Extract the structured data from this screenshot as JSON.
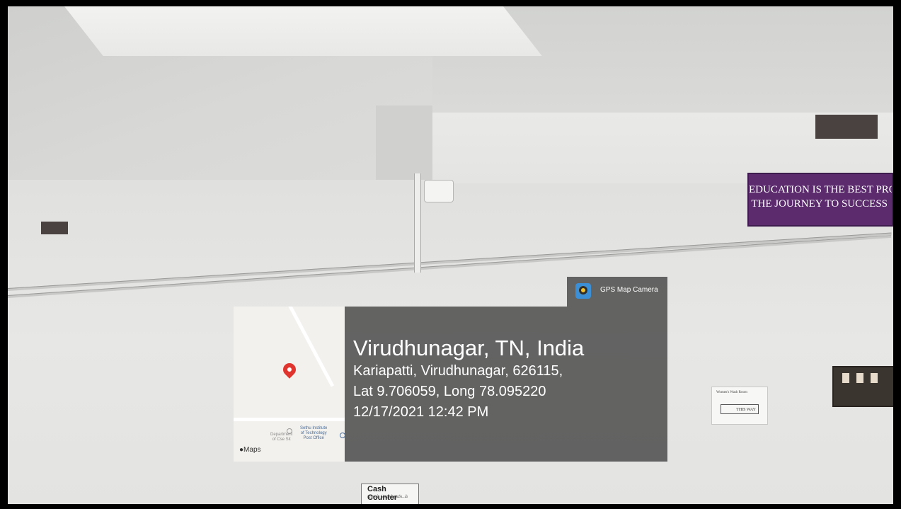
{
  "gps_badge": {
    "app_name": "GPS Map Camera",
    "icon": "gps-map-camera-app-icon"
  },
  "location_card": {
    "city_line": "Virudhunagar, TN, India",
    "address_line": "Kariapatti, Virudhunagar, 626115,",
    "coords_line": "Lat 9.706059, Long 78.095220",
    "datetime_line": "12/17/2021 12:42 PM"
  },
  "map_thumbnail": {
    "provider_label": "Maps",
    "poi_department": "Department\nof Cse Sit",
    "poi_sethu": "Sethu Institute\nof Technology\nPost Office",
    "pin_icon": "map-pin-icon",
    "pin_color": "#e0342f"
  },
  "scene_signs": {
    "banner_line1": "EDUCATION IS THE BEST PROVISIC",
    "banner_line2": "THE JOURNEY TO SUCCESS",
    "banner_color": "#5b2b6e",
    "washroom_title": "Women's Wash Room",
    "washroom_direction": "THIS WAY",
    "cash_counter_title": "Cash Counter",
    "cash_counter_subtitle": "பணம் செலுத்துமிடம்"
  }
}
